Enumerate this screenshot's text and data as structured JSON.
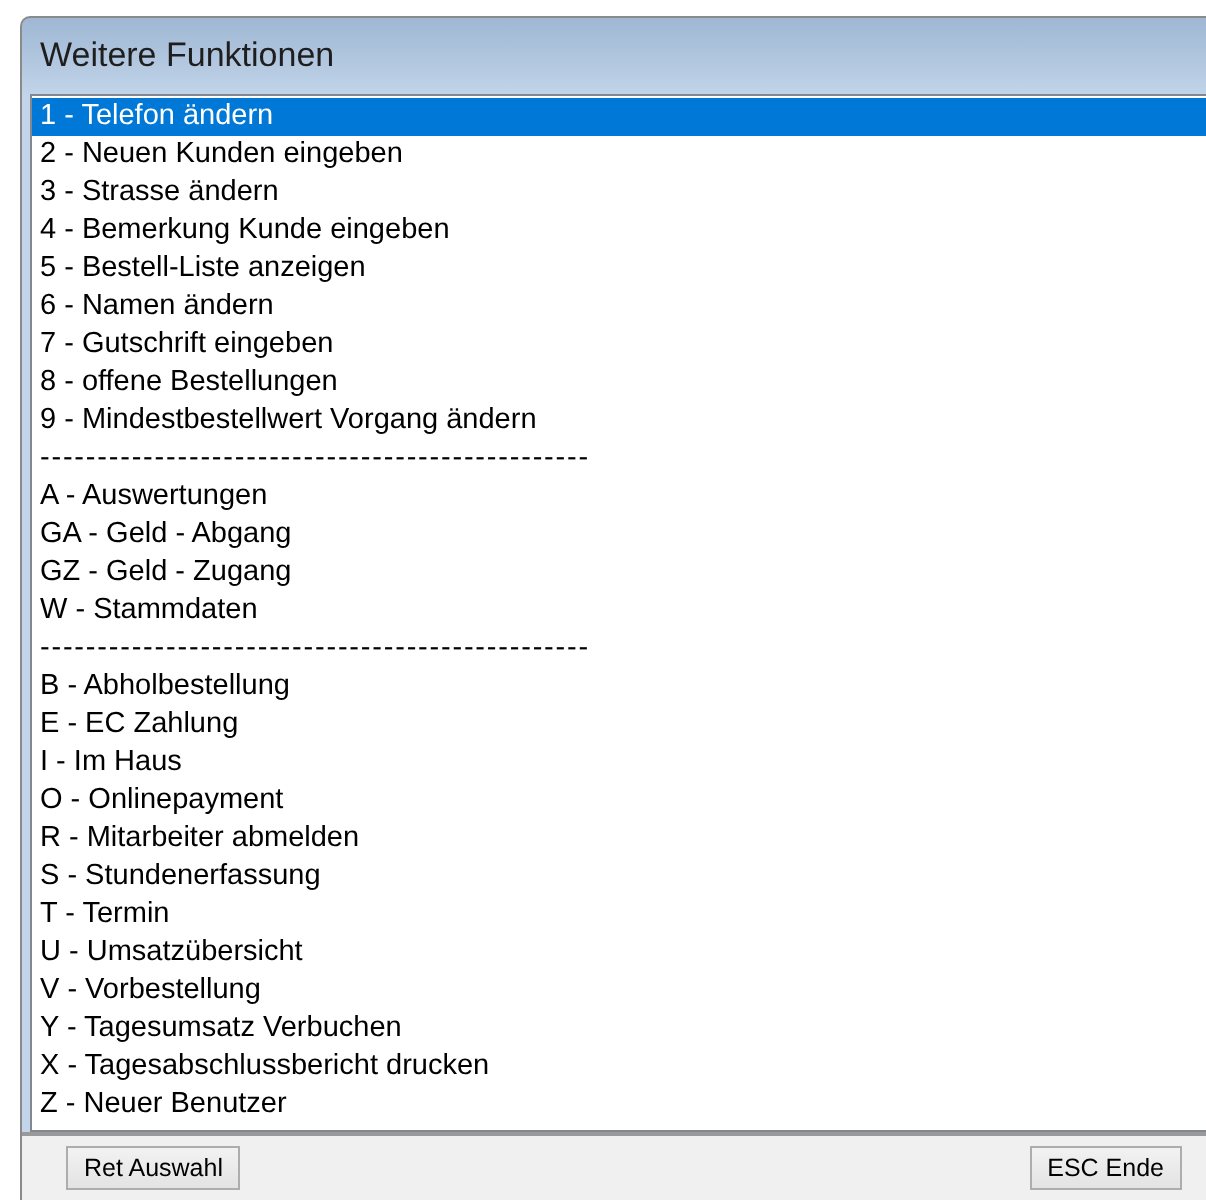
{
  "window": {
    "title": "Weitere Funktionen"
  },
  "list": [
    {
      "kind": "item",
      "label": "1 - Telefon ändern",
      "selected": true
    },
    {
      "kind": "item",
      "label": "2 - Neuen Kunden eingeben",
      "selected": false
    },
    {
      "kind": "item",
      "label": "3 - Strasse ändern",
      "selected": false
    },
    {
      "kind": "item",
      "label": "4 - Bemerkung Kunde eingeben",
      "selected": false
    },
    {
      "kind": "item",
      "label": "5 - Bestell-Liste anzeigen",
      "selected": false
    },
    {
      "kind": "item",
      "label": "6 - Namen ändern",
      "selected": false
    },
    {
      "kind": "item",
      "label": "7 - Gutschrift eingeben",
      "selected": false
    },
    {
      "kind": "item",
      "label": "8 - offene Bestellungen",
      "selected": false
    },
    {
      "kind": "item",
      "label": "9 - Mindestbestellwert Vorgang ändern",
      "selected": false
    },
    {
      "kind": "separator",
      "label": "------------------------------------------------",
      "selected": false
    },
    {
      "kind": "item",
      "label": "A - Auswertungen",
      "selected": false
    },
    {
      "kind": "item",
      "label": "GA - Geld - Abgang",
      "selected": false
    },
    {
      "kind": "item",
      "label": "GZ - Geld - Zugang",
      "selected": false
    },
    {
      "kind": "item",
      "label": "W - Stammdaten",
      "selected": false
    },
    {
      "kind": "separator",
      "label": "------------------------------------------------",
      "selected": false
    },
    {
      "kind": "item",
      "label": "B - Abholbestellung",
      "selected": false
    },
    {
      "kind": "item",
      "label": "E - EC Zahlung",
      "selected": false
    },
    {
      "kind": "item",
      "label": "I - Im Haus",
      "selected": false
    },
    {
      "kind": "item",
      "label": "O - Onlinepayment",
      "selected": false
    },
    {
      "kind": "item",
      "label": "R - Mitarbeiter abmelden",
      "selected": false
    },
    {
      "kind": "item",
      "label": "S - Stundenerfassung",
      "selected": false
    },
    {
      "kind": "item",
      "label": "T - Termin",
      "selected": false
    },
    {
      "kind": "item",
      "label": "U - Umsatzübersicht",
      "selected": false
    },
    {
      "kind": "item",
      "label": "V - Vorbestellung",
      "selected": false
    },
    {
      "kind": "item",
      "label": "Y - Tagesumsatz Verbuchen",
      "selected": false
    },
    {
      "kind": "item",
      "label": "X - Tagesabschlussbericht drucken",
      "selected": false
    },
    {
      "kind": "item",
      "label": "Z - Neuer Benutzer",
      "selected": false
    }
  ],
  "buttons": [
    "Ret Auswahl",
    "ESC Ende"
  ]
}
